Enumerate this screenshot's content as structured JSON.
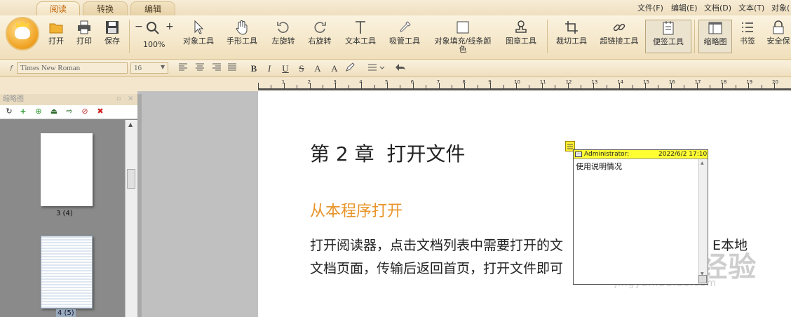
{
  "tabs": [
    {
      "label": "阅读",
      "active": true
    },
    {
      "label": "转换",
      "active": false
    },
    {
      "label": "编辑",
      "active": false
    }
  ],
  "menu": [
    "文件(F)",
    "编辑(E)",
    "文档(D)",
    "文本(T)",
    "对象("
  ],
  "ribbon": {
    "open": "打开",
    "print": "打印",
    "save": "保存",
    "zoom": "100%",
    "zoom_minus": "−",
    "zoom_plus": "+",
    "object_tool": "对象工具",
    "hand_tool": "手形工具",
    "rotate_left": "左旋转",
    "rotate_right": "右旋转",
    "text_tool": "文本工具",
    "eyedropper_tool": "吸管工具",
    "fill_tool_line1": "对象填充/线条颜",
    "fill_tool_line2": "色",
    "stamp_tool": "图章工具",
    "crop_tool": "裁切工具",
    "hyperlink_tool": "超链接工具",
    "note_tool": "便签工具",
    "thumbnail": "缩略图",
    "bookmark": "书签",
    "security": "安全保"
  },
  "format_bar": {
    "font_family": "Times New Roman",
    "font_size": "16",
    "bold": "B",
    "italic": "I",
    "underline": "U",
    "strike": "S",
    "superscript": "A",
    "subscript": "A"
  },
  "ruler_numbers": [
    "1",
    "2",
    "3",
    "4",
    "5",
    "6",
    "7",
    "8",
    "9",
    "10",
    "11",
    "12",
    "13",
    "14",
    "15",
    "16",
    "17",
    "18",
    "19",
    "20"
  ],
  "sidepanel": {
    "title": "缩略图",
    "thumbnails": [
      {
        "label": "3 (4)"
      },
      {
        "label": "4 (5)"
      }
    ]
  },
  "document": {
    "chapter_title": "第 2 章  打开文件",
    "section_title": "从本程序打开",
    "paragraph_line1": "打开阅读器，点击文档列表中需要打开的文",
    "paragraph_line1_tail": "E本地",
    "paragraph_line2": "文档页面，传输后返回首页，打开文件即可"
  },
  "note": {
    "author": "Administrator:",
    "timestamp": "2022/6/2 17:10",
    "content": "使用说明情况"
  },
  "watermark": {
    "brand": "Baidu经验",
    "url": "jingyan.baidu.com"
  },
  "colors": {
    "accent_orange": "#e8942a",
    "note_yellow": "#ffff33",
    "ribbon_bg": "#f3e6cc"
  }
}
